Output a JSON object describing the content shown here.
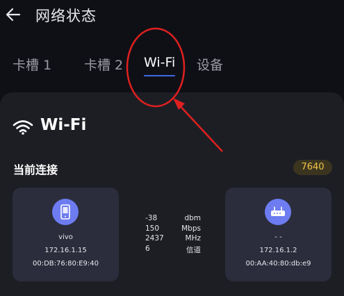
{
  "header": {
    "title": "网络状态",
    "back_icon": "back-arrow-icon"
  },
  "tabs": [
    {
      "label": "卡槽 1",
      "active": false
    },
    {
      "label": "卡槽 2",
      "active": false
    },
    {
      "label": "Wi-Fi",
      "active": true
    },
    {
      "label": "设备",
      "active": false
    }
  ],
  "card": {
    "title": "Wi-Fi",
    "icon": "wifi-icon",
    "section_label": "当前连接",
    "badge": "7640",
    "local_device": {
      "icon": "phone-icon",
      "name": "vivo",
      "ip": "172.16.1.15",
      "mac": "00:DB:76:80:E9:40"
    },
    "stats": [
      {
        "value": "-38",
        "unit": "dbm"
      },
      {
        "value": "150",
        "unit": "Mbps"
      },
      {
        "value": "2437",
        "unit": "MHz"
      },
      {
        "value": "6",
        "unit": "信道"
      }
    ],
    "remote_device": {
      "icon": "router-icon",
      "name": "- -",
      "ip": "172.16.1.2",
      "mac": "00:AA:40:80:db:e9"
    }
  },
  "colors": {
    "accent": "#3f69e6",
    "badge_text": "#f2c548",
    "annotation": "#e02020",
    "device_icon": "#6d7cf0"
  }
}
